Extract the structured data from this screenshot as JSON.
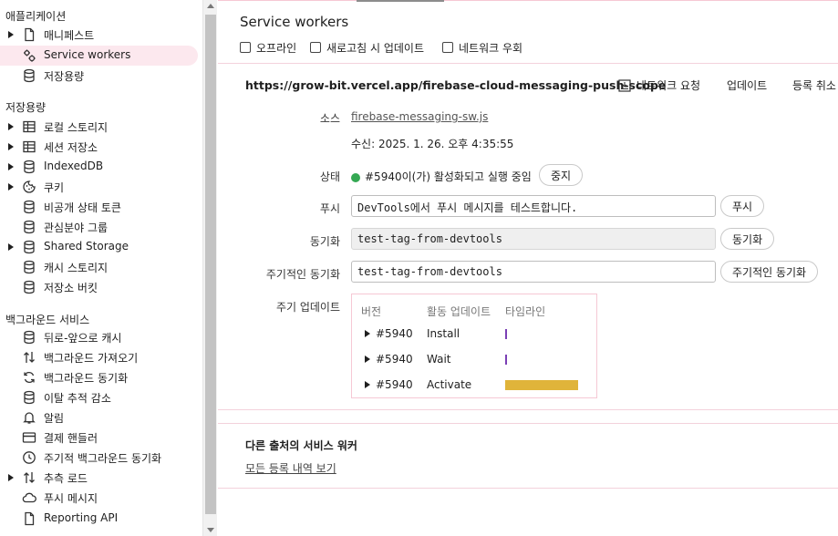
{
  "sidebar": {
    "app_section": "애플리케이션",
    "app_items": [
      {
        "label": "매니페스트",
        "icon": "document-icon",
        "expandable": true
      },
      {
        "label": "Service workers",
        "icon": "gears-icon",
        "expandable": false,
        "selected": true
      },
      {
        "label": "저장용량",
        "icon": "database-icon",
        "expandable": false
      }
    ],
    "storage_section": "저장용량",
    "storage_items": [
      {
        "label": "로컬 스토리지",
        "icon": "table-icon",
        "expandable": true
      },
      {
        "label": "세션 저장소",
        "icon": "table-icon",
        "expandable": true
      },
      {
        "label": "IndexedDB",
        "icon": "database-icon",
        "expandable": true
      },
      {
        "label": "쿠키",
        "icon": "cookie-icon",
        "expandable": true
      },
      {
        "label": "비공개 상태 토큰",
        "icon": "database-icon",
        "expandable": false
      },
      {
        "label": "관심분야 그룹",
        "icon": "database-icon",
        "expandable": false
      },
      {
        "label": "Shared Storage",
        "icon": "database-icon",
        "expandable": true
      },
      {
        "label": "캐시 스토리지",
        "icon": "database-icon",
        "expandable": false
      },
      {
        "label": "저장소 버킷",
        "icon": "database-icon",
        "expandable": false
      }
    ],
    "bg_section": "백그라운드 서비스",
    "bg_items": [
      {
        "label": "뒤로-앞으로 캐시",
        "icon": "database-icon",
        "expandable": false
      },
      {
        "label": "백그라운드 가져오기",
        "icon": "arrows-updown-icon",
        "expandable": false
      },
      {
        "label": "백그라운드 동기화",
        "icon": "sync-icon",
        "expandable": false
      },
      {
        "label": "이탈 추적 감소",
        "icon": "database-icon",
        "expandable": false
      },
      {
        "label": "알림",
        "icon": "bell-icon",
        "expandable": false
      },
      {
        "label": "결제 핸들러",
        "icon": "card-icon",
        "expandable": false
      },
      {
        "label": "주기적 백그라운드 동기화",
        "icon": "clock-icon",
        "expandable": false
      },
      {
        "label": "추측 로드",
        "icon": "arrows-updown-icon",
        "expandable": true
      },
      {
        "label": "푸시 메시지",
        "icon": "cloud-icon",
        "expandable": false
      },
      {
        "label": "Reporting API",
        "icon": "document-icon",
        "expandable": false
      }
    ]
  },
  "main": {
    "title": "Service workers",
    "options": [
      "오프라인",
      "새로고침 시 업데이트",
      "네트워크 우회"
    ],
    "scope_url": "https://grow-bit.vercel.app/firebase-cloud-messaging-push-scope",
    "actions": {
      "network_requests": "네트워크 요청",
      "update": "업데이트",
      "unregister": "등록 취소"
    },
    "source_label": "소스",
    "source_file": "firebase-messaging-sw.js",
    "received": "수신: 2025. 1. 26. 오후 4:35:55",
    "status_label": "상태",
    "status_text": "#5940이(가) 활성화되고 실행 중임",
    "stop_button": "중지",
    "push_label": "푸시",
    "push_value": "DevTools에서 푸시 메시지를 테스트합니다.",
    "push_button": "푸시",
    "sync_label": "동기화",
    "sync_value": "test-tag-from-devtools",
    "sync_button": "동기화",
    "periodic_label": "주기적인 동기화",
    "periodic_value": "test-tag-from-devtools",
    "periodic_button": "주기적인 동기화",
    "update_cycle_label": "주기 업데이트",
    "timeline": {
      "headers": [
        "버전",
        "활동 업데이트",
        "타임라인"
      ],
      "rows": [
        {
          "version": "#5940",
          "activity": "Install",
          "bar_color": "#7b3fb5",
          "bar_fraction": 0.02
        },
        {
          "version": "#5940",
          "activity": "Wait",
          "bar_color": "#7b3fb5",
          "bar_fraction": 0.02
        },
        {
          "version": "#5940",
          "activity": "Activate",
          "bar_color": "#e0b43a",
          "bar_fraction": 1.0
        }
      ]
    },
    "other_origins_title": "다른 출처의 서비스 워커",
    "see_all_link": "모든 등록 내역 보기"
  }
}
